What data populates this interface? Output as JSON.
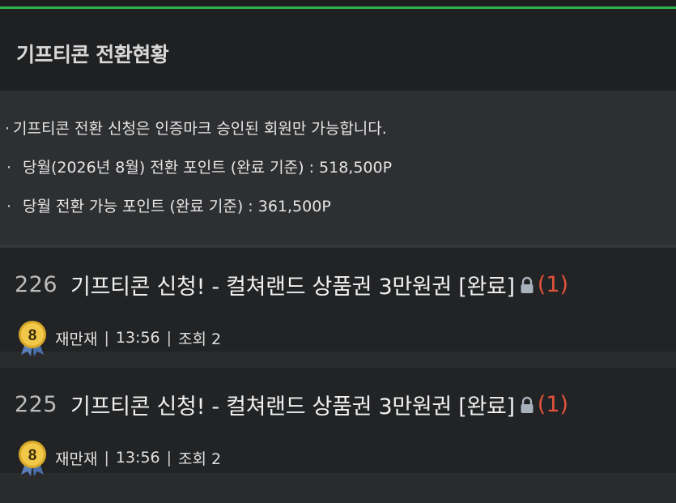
{
  "header": {
    "title": "기프티콘 전환현황"
  },
  "info": {
    "lines": [
      {
        "bullet": "·",
        "text": "기프티콘 전환 신청은 인증마크 승인된 회원만 가능합니다."
      },
      {
        "bullet": "·",
        "text": "당월(2026년 8월) 전환 포인트 (완료 기준) : 518,500P"
      },
      {
        "bullet": "·",
        "text": "당월 전환 가능 포인트 (완료 기준) : 361,500P"
      }
    ]
  },
  "posts": [
    {
      "number": "226",
      "title": "기프티콘 신청! - 컬쳐랜드 상품권 3만원권 [완료]",
      "comments": "(1)",
      "level": "8",
      "author": "재만재",
      "time": "13:56",
      "views": "조회 2"
    },
    {
      "number": "225",
      "title": "기프티콘 신청! - 컬쳐랜드 상품권 3만원권 [완료]",
      "comments": "(1)",
      "level": "8",
      "author": "재만재",
      "time": "13:56",
      "views": "조회 2"
    }
  ],
  "meta": {
    "separator": "|"
  },
  "colors": {
    "accent": "#2db34a",
    "comment": "#e5533d",
    "badge": "#d8a928"
  },
  "icons": {
    "lock": "lock-icon",
    "level": "level-badge-icon"
  }
}
